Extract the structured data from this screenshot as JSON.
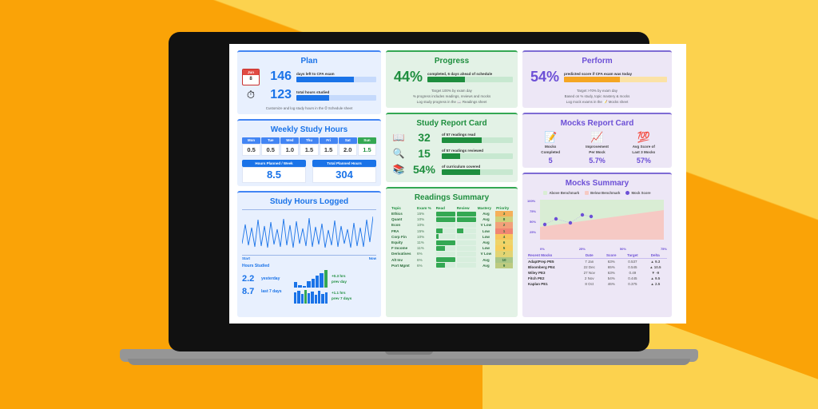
{
  "plan": {
    "title": "Plan",
    "calendar": {
      "month": "Jun",
      "day": "8"
    },
    "timer_icon": "stopwatch-icon",
    "rows": [
      {
        "value": "146",
        "label": "days left to CFA exam",
        "pct": 72
      },
      {
        "value": "123",
        "label": "total hours studied",
        "pct": 41
      }
    ],
    "footer": "Customize and log study hours in the ⏱ Schedule sheet"
  },
  "weekly": {
    "title": "Weekly Study Hours",
    "days": [
      "Mon",
      "Tue",
      "Wed",
      "Thu",
      "Fri",
      "Sat",
      "Sun"
    ],
    "hours": [
      "0.5",
      "0.5",
      "1.0",
      "1.5",
      "1.5",
      "2.0",
      "1.5"
    ],
    "kpis": [
      {
        "label": "Hours Planned  / Week",
        "value": "8.5"
      },
      {
        "label": "Total Planned Hours",
        "value": "304"
      }
    ]
  },
  "logged": {
    "title": "Study Hours Logged",
    "axis_start": "Start",
    "axis_end": "Now",
    "section_label": "Hours Studied",
    "rows": [
      {
        "value": "2.2",
        "label": "yesterday",
        "delta": "+0.3 hrs",
        "delta_sub": "prev day"
      },
      {
        "value": "8.7",
        "label": "last 7 days",
        "delta": "+1.1 hrs",
        "delta_sub": "prev 7 days"
      }
    ]
  },
  "progress": {
    "title": "Progress",
    "value": "44%",
    "label": "completed, 6 days ahead of schedule",
    "pct": 44,
    "footer_lines": [
      "Target 100% by exam day",
      "% progress includes readings, reviews and mocks",
      "Log study progress in the 📖 Readings sheet"
    ]
  },
  "study_report": {
    "title": "Study Report Card",
    "rows": [
      {
        "icon": "book-icon",
        "glyph": "📖",
        "value": "32",
        "label": "of 57 readings read",
        "pct": 56
      },
      {
        "icon": "magnifier-icon",
        "glyph": "🔍",
        "value": "15",
        "label": "of 57 readings reviewed",
        "pct": 26
      },
      {
        "icon": "books-icon",
        "glyph": "📚",
        "value": "54%",
        "label": "of curriculum covered",
        "pct": 54
      }
    ]
  },
  "readings": {
    "title": "Readings Summary",
    "columns": [
      "Topic",
      "Exam %",
      "Read",
      "Review",
      "Mastery",
      "Priority"
    ],
    "rows": [
      {
        "topic": "Ethics",
        "exam": "15%",
        "read": 100,
        "review": 100,
        "mastery": "Avg",
        "priority": "3"
      },
      {
        "topic": "Quant",
        "exam": "10%",
        "read": 100,
        "review": 100,
        "mastery": "Avg",
        "priority": "8"
      },
      {
        "topic": "Econ",
        "exam": "10%",
        "read": 0,
        "review": 0,
        "mastery": "V Low",
        "priority": "2"
      },
      {
        "topic": "FRA",
        "exam": "15%",
        "read": 35,
        "review": 35,
        "mastery": "Low",
        "priority": "1"
      },
      {
        "topic": "Corp Fin",
        "exam": "10%",
        "read": 12,
        "review": 0,
        "mastery": "Low",
        "priority": "4"
      },
      {
        "topic": "Equity",
        "exam": "11%",
        "read": 100,
        "review": 0,
        "mastery": "Avg",
        "priority": "6"
      },
      {
        "topic": "F Income",
        "exam": "11%",
        "read": 45,
        "review": 0,
        "mastery": "Low",
        "priority": "5"
      },
      {
        "topic": "Derivatives",
        "exam": "6%",
        "read": 0,
        "review": 0,
        "mastery": "V Low",
        "priority": "7"
      },
      {
        "topic": "Alt Inv",
        "exam": "6%",
        "read": 100,
        "review": 0,
        "mastery": "Avg",
        "priority": "10"
      },
      {
        "topic": "Port Mgmt",
        "exam": "6%",
        "read": 45,
        "review": 0,
        "mastery": "Avg",
        "priority": "9"
      }
    ]
  },
  "perform": {
    "title": "Perform",
    "value": "54%",
    "label": "predicted score if CFA exam was today",
    "pct": 54,
    "footer_lines": [
      "Target >70% by exam day",
      "Based on % study, topic mastery & mocks",
      "Log mock exams in the 📝 Mocks sheet"
    ]
  },
  "mocks_report": {
    "title": "Mocks Report Card",
    "items": [
      {
        "glyph": "📝",
        "icon": "memo-icon",
        "label": "Mocks\nCompleted",
        "value": "5"
      },
      {
        "glyph": "📈",
        "icon": "chart-increasing-icon",
        "label": "Improvement\nPer Mock",
        "value": "5.7%"
      },
      {
        "glyph": "💯",
        "icon": "hundred-points-icon",
        "label": "Avg Score of\nLast 3 Mocks",
        "value": "57%"
      }
    ]
  },
  "mocks_summary": {
    "title": "Mocks Summary",
    "legend": [
      {
        "label": "Above Benchmark",
        "color": "#D9EDD4"
      },
      {
        "label": "Below Benchmark",
        "color": "#F6C9C4"
      },
      {
        "label": "Mock Score",
        "color": "#6C4FD6"
      }
    ],
    "table_columns": [
      "Recent Mocks",
      "Date",
      "Score",
      "Target",
      "Delta"
    ],
    "table_rows": [
      {
        "name": "AdaptPrep PE5",
        "date": "7 Jan",
        "score": "63%",
        "target": "0.537",
        "delta": "9.3",
        "dir": "up"
      },
      {
        "name": "Bloomberg PE4",
        "date": "22 Dec",
        "score": "65%",
        "target": "0.545",
        "delta": "10.5",
        "dir": "up"
      },
      {
        "name": "Wiley PE3",
        "date": "27 Nov",
        "score": "63%",
        "target": "0.49",
        "delta": "-9",
        "dir": "down"
      },
      {
        "name": "Fitch PE2",
        "date": "2 Nov",
        "score": "54%",
        "target": "0.445",
        "delta": "9.5",
        "dir": "up"
      },
      {
        "name": "Kaplan PE1",
        "date": "8 Oct",
        "score": "46%",
        "target": "0.375",
        "delta": "2.5",
        "dir": "up"
      }
    ]
  },
  "chart_data": {
    "type": "scatter",
    "title": "Mocks Summary",
    "xlabel": "",
    "ylabel": "",
    "xlim": [
      0,
      100
    ],
    "ylim": [
      0,
      100
    ],
    "x_ticks": [
      "0%",
      "25%",
      "50%",
      "75%"
    ],
    "y_ticks": [
      "100%",
      "75%",
      "50%",
      "25%"
    ],
    "series": [
      {
        "name": "Mock Score",
        "color": "#6C4FD6",
        "points": [
          [
            4,
            40
          ],
          [
            13,
            53
          ],
          [
            24,
            44
          ],
          [
            34,
            65
          ],
          [
            41,
            62
          ]
        ]
      }
    ],
    "bands": [
      {
        "name": "Above Benchmark",
        "color": "#D9EDD4"
      },
      {
        "name": "Below Benchmark",
        "color": "#F6C9C4"
      }
    ],
    "benchmark_line": [
      [
        0,
        37
      ],
      [
        100,
        75
      ]
    ],
    "legend_position": "top"
  }
}
